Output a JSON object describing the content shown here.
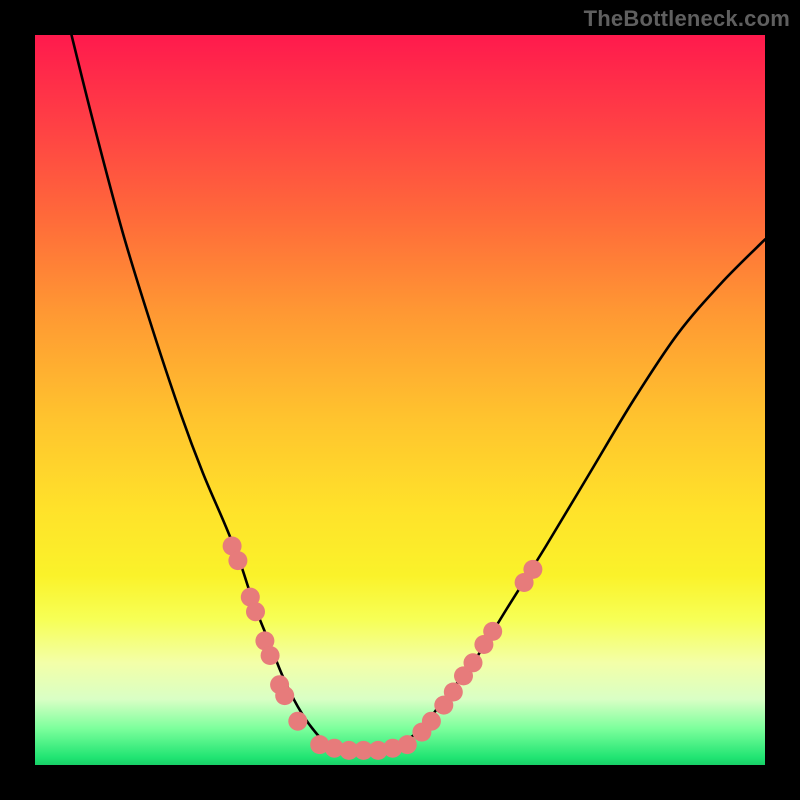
{
  "watermark": "TheBottleneck.com",
  "chart_data": {
    "type": "line",
    "title": "",
    "xlabel": "",
    "ylabel": "",
    "xlim": [
      0,
      100
    ],
    "ylim": [
      0,
      100
    ],
    "grid": false,
    "series": [
      {
        "name": "curve",
        "color": "#000000",
        "x": [
          5,
          8,
          12,
          16,
          20,
          23,
          26,
          28,
          30,
          32,
          34,
          36,
          38,
          40,
          43,
          47,
          50,
          53,
          56,
          60,
          65,
          70,
          76,
          82,
          88,
          94,
          100
        ],
        "y": [
          100,
          88,
          73,
          60,
          48,
          40,
          33,
          28,
          22,
          17,
          12,
          8,
          5,
          3,
          2,
          2,
          3,
          5,
          9,
          14,
          22,
          30,
          40,
          50,
          59,
          66,
          72
        ]
      }
    ],
    "markers": {
      "name": "dots",
      "color": "#e77b7b",
      "radius_pct": 1.3,
      "points": [
        {
          "x": 27,
          "y": 30
        },
        {
          "x": 27.8,
          "y": 28
        },
        {
          "x": 29.5,
          "y": 23
        },
        {
          "x": 30.2,
          "y": 21
        },
        {
          "x": 31.5,
          "y": 17
        },
        {
          "x": 32.2,
          "y": 15
        },
        {
          "x": 33.5,
          "y": 11
        },
        {
          "x": 34.2,
          "y": 9.5
        },
        {
          "x": 36,
          "y": 6
        },
        {
          "x": 39,
          "y": 2.8
        },
        {
          "x": 41,
          "y": 2.3
        },
        {
          "x": 43,
          "y": 2
        },
        {
          "x": 45,
          "y": 2
        },
        {
          "x": 47,
          "y": 2
        },
        {
          "x": 49,
          "y": 2.3
        },
        {
          "x": 51,
          "y": 2.8
        },
        {
          "x": 53,
          "y": 4.5
        },
        {
          "x": 54.3,
          "y": 6
        },
        {
          "x": 56,
          "y": 8.2
        },
        {
          "x": 57.3,
          "y": 10
        },
        {
          "x": 58.7,
          "y": 12.2
        },
        {
          "x": 60,
          "y": 14
        },
        {
          "x": 61.5,
          "y": 16.5
        },
        {
          "x": 62.7,
          "y": 18.3
        },
        {
          "x": 67,
          "y": 25
        },
        {
          "x": 68.2,
          "y": 26.8
        }
      ]
    }
  }
}
